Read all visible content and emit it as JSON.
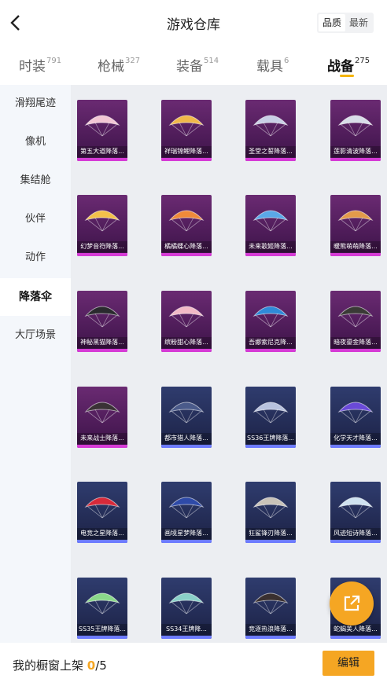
{
  "header": {
    "title": "游戏仓库",
    "sort_options": [
      "品质",
      "最新"
    ],
    "sort_active": "品质"
  },
  "tabs": [
    {
      "label": "时装",
      "count": "791"
    },
    {
      "label": "枪械",
      "count": "327"
    },
    {
      "label": "装备",
      "count": "514"
    },
    {
      "label": "载具",
      "count": "6"
    },
    {
      "label": "战备",
      "count": "275"
    }
  ],
  "active_tab": "战备",
  "sidebar": {
    "items": [
      "滑翔尾迹",
      "像机",
      "集结舱",
      "伙伴",
      "动作",
      "降落伞",
      "大厅场景"
    ],
    "active": "降落伞"
  },
  "items": [
    {
      "name": "第五大道降落...",
      "rarity": "purple",
      "color": "#f2c6d4",
      "icon": "parachute-icon"
    },
    {
      "name": "祥瑞锦鲤降落...",
      "rarity": "purple",
      "color": "#f0b84a",
      "icon": "parachute-icon"
    },
    {
      "name": "圣堂之誓降落...",
      "rarity": "purple",
      "color": "#c9cfe6",
      "icon": "parachute-icon"
    },
    {
      "name": "莲影清波降落...",
      "rarity": "purple",
      "color": "#d8dde8",
      "icon": "parachute-icon"
    },
    {
      "name": "幻梦音符降落...",
      "rarity": "purple",
      "color": "#f4c14a",
      "icon": "parachute-icon"
    },
    {
      "name": "橘橘蝶心降落...",
      "rarity": "purple",
      "color": "#f08a3a",
      "icon": "parachute-icon"
    },
    {
      "name": "未来歌姬降落...",
      "rarity": "purple",
      "color": "#5aa8e8",
      "icon": "parachute-icon"
    },
    {
      "name": "暖熊萌萌降落...",
      "rarity": "purple",
      "color": "#e39a4a",
      "icon": "parachute-icon"
    },
    {
      "name": "神秘黑猫降落...",
      "rarity": "purple",
      "color": "#2a2a2e",
      "icon": "parachute-icon"
    },
    {
      "name": "缤粉甜心降落...",
      "rarity": "purple",
      "color": "#f2b9c6",
      "icon": "parachute-icon"
    },
    {
      "name": "吾娜索尼克降...",
      "rarity": "purple",
      "color": "#2f8ad8",
      "icon": "parachute-icon"
    },
    {
      "name": "暗夜鎏金降落...",
      "rarity": "purple",
      "color": "#3a3a36",
      "icon": "parachute-icon"
    },
    {
      "name": "未来战士降落...",
      "rarity": "purple",
      "color": "#3a3236",
      "icon": "parachute-icon"
    },
    {
      "name": "都市猎人降落...",
      "rarity": "blue",
      "color": "#4a5a8a",
      "icon": "parachute-icon"
    },
    {
      "name": "SS36王牌降落...",
      "rarity": "blue",
      "color": "#b8c2de",
      "icon": "parachute-icon"
    },
    {
      "name": "化学天才降落...",
      "rarity": "blue",
      "color": "#6a4ad8",
      "icon": "parachute-icon"
    },
    {
      "name": "电竞之星降落...",
      "rarity": "blue",
      "color": "#d82a3a",
      "icon": "parachute-icon"
    },
    {
      "name": "画境星梦降落...",
      "rarity": "blue",
      "color": "#2e4aa8",
      "icon": "parachute-icon"
    },
    {
      "name": "狂鲨锋刃降落...",
      "rarity": "blue",
      "color": "#c8c2b8",
      "icon": "parachute-icon"
    },
    {
      "name": "风迹短诗降落...",
      "rarity": "blue",
      "color": "#cfe2f0",
      "icon": "parachute-icon"
    },
    {
      "name": "SS35王牌降落...",
      "rarity": "blue",
      "color": "#8ad88a",
      "icon": "parachute-icon"
    },
    {
      "name": "SS34王牌降...",
      "rarity": "blue",
      "color": "#8ad0c8",
      "icon": "parachute-icon"
    },
    {
      "name": "竞逐热浪降落...",
      "rarity": "blue",
      "color": "#3a3030",
      "icon": "parachute-icon"
    },
    {
      "name": "蛇蝎美人降落...",
      "rarity": "blue",
      "color": "#d8d0e0",
      "icon": "parachute-icon"
    }
  ],
  "footer": {
    "label": "我的橱窗上架",
    "current": "0",
    "total": "/5",
    "edit_label": "编辑"
  },
  "colors": {
    "accent": "#f5a623",
    "rarity_purple": "#d63bd6",
    "rarity_blue": "#6d7bff"
  }
}
